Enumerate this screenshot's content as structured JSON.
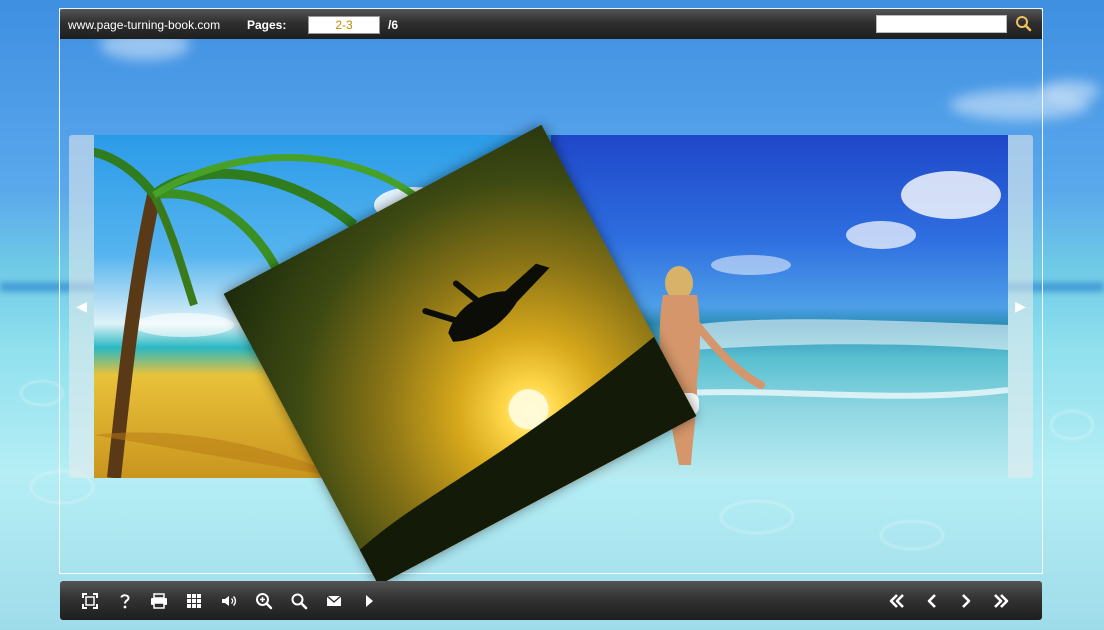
{
  "header": {
    "site": "www.page-turning-book.com",
    "pages_label": "Pages:",
    "page_value": "2-3",
    "page_total": "/6",
    "search_value": ""
  },
  "book": {
    "prev_arrow": "◀",
    "next_arrow": "▶"
  },
  "toolbar": {
    "left_buttons": [
      "fullscreen-icon",
      "help-icon",
      "print-icon",
      "thumbnails-icon",
      "sound-icon",
      "zoom-in-icon",
      "search-icon",
      "email-icon",
      "autoplay-icon"
    ],
    "right_buttons": [
      "first-page-icon",
      "previous-page-icon",
      "next-page-icon",
      "last-page-icon"
    ]
  }
}
